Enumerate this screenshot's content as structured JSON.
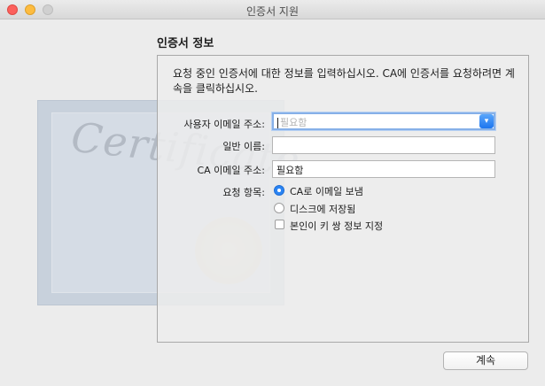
{
  "window": {
    "title": "인증서 지원"
  },
  "section": {
    "title": "인증서 정보"
  },
  "description": "요청 중인 인증서에 대한 정보를 입력하십시오. CA에 인증서를 요청하려면 계속을 클릭하십시오.",
  "form": {
    "user_email": {
      "label": "사용자 이메일 주소:",
      "placeholder": "필요함",
      "value": ""
    },
    "common_name": {
      "label": "일반 이름:",
      "value": ""
    },
    "ca_email": {
      "label": "CA 이메일 주소:",
      "value": "필요함"
    },
    "request": {
      "label": "요청 항목:",
      "options": [
        {
          "label": "CA로 이메일 보냄",
          "selected": true
        },
        {
          "label": "디스크에 저장됨",
          "selected": false
        }
      ],
      "checkbox": {
        "label": "본인이 키 쌍 정보 지정",
        "checked": false
      }
    }
  },
  "decor": {
    "certificate_text": "Certificate"
  },
  "buttons": {
    "continue": "계속"
  },
  "colors": {
    "accent": "#2a84f3",
    "focus_ring": "#86b0e8"
  }
}
